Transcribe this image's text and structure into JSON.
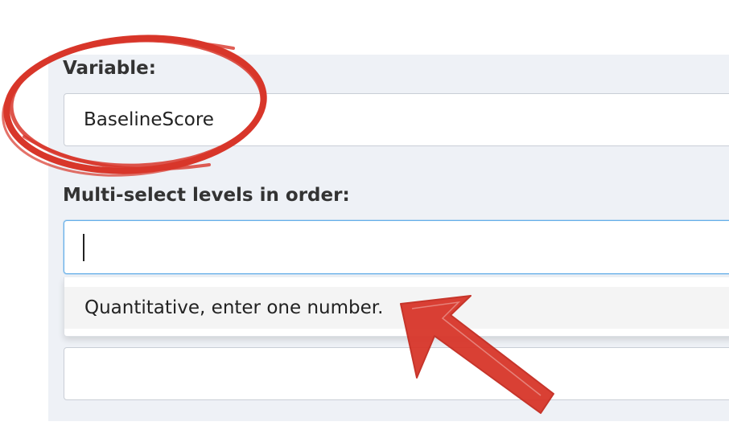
{
  "form": {
    "variable_label": "Variable:",
    "variable_value": "BaselineScore",
    "levels_label": "Multi-select levels in order:",
    "levels_value": "",
    "dropdown_option": "Quantitative, enter one number."
  },
  "annotations": {
    "circle_color": "#d8362a",
    "arrow_color": "#d8362a"
  },
  "colors": {
    "panel_background": "#eef1f6",
    "focus_border": "#66afe9"
  }
}
